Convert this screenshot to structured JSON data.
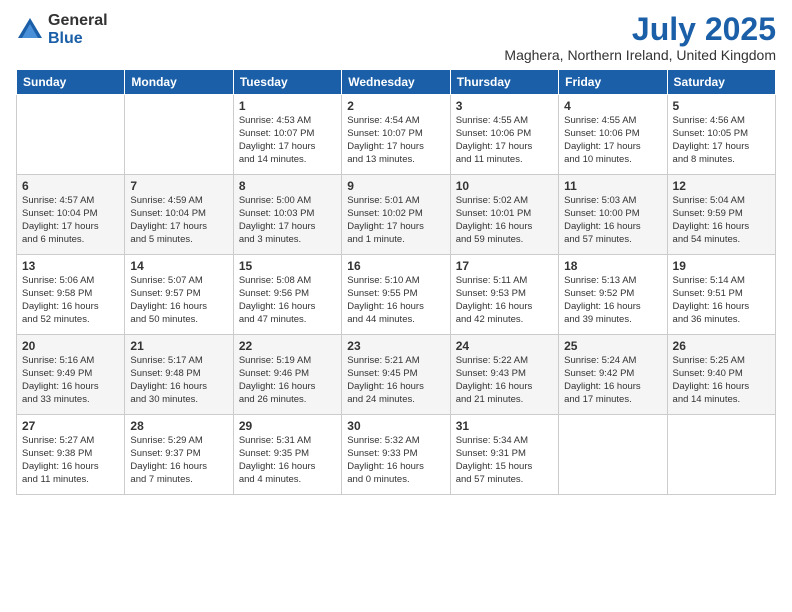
{
  "logo": {
    "general": "General",
    "blue": "Blue"
  },
  "title": {
    "month": "July 2025",
    "location": "Maghera, Northern Ireland, United Kingdom"
  },
  "headers": [
    "Sunday",
    "Monday",
    "Tuesday",
    "Wednesday",
    "Thursday",
    "Friday",
    "Saturday"
  ],
  "weeks": [
    [
      {
        "day": "",
        "info": ""
      },
      {
        "day": "",
        "info": ""
      },
      {
        "day": "1",
        "info": "Sunrise: 4:53 AM\nSunset: 10:07 PM\nDaylight: 17 hours\nand 14 minutes."
      },
      {
        "day": "2",
        "info": "Sunrise: 4:54 AM\nSunset: 10:07 PM\nDaylight: 17 hours\nand 13 minutes."
      },
      {
        "day": "3",
        "info": "Sunrise: 4:55 AM\nSunset: 10:06 PM\nDaylight: 17 hours\nand 11 minutes."
      },
      {
        "day": "4",
        "info": "Sunrise: 4:55 AM\nSunset: 10:06 PM\nDaylight: 17 hours\nand 10 minutes."
      },
      {
        "day": "5",
        "info": "Sunrise: 4:56 AM\nSunset: 10:05 PM\nDaylight: 17 hours\nand 8 minutes."
      }
    ],
    [
      {
        "day": "6",
        "info": "Sunrise: 4:57 AM\nSunset: 10:04 PM\nDaylight: 17 hours\nand 6 minutes."
      },
      {
        "day": "7",
        "info": "Sunrise: 4:59 AM\nSunset: 10:04 PM\nDaylight: 17 hours\nand 5 minutes."
      },
      {
        "day": "8",
        "info": "Sunrise: 5:00 AM\nSunset: 10:03 PM\nDaylight: 17 hours\nand 3 minutes."
      },
      {
        "day": "9",
        "info": "Sunrise: 5:01 AM\nSunset: 10:02 PM\nDaylight: 17 hours\nand 1 minute."
      },
      {
        "day": "10",
        "info": "Sunrise: 5:02 AM\nSunset: 10:01 PM\nDaylight: 16 hours\nand 59 minutes."
      },
      {
        "day": "11",
        "info": "Sunrise: 5:03 AM\nSunset: 10:00 PM\nDaylight: 16 hours\nand 57 minutes."
      },
      {
        "day": "12",
        "info": "Sunrise: 5:04 AM\nSunset: 9:59 PM\nDaylight: 16 hours\nand 54 minutes."
      }
    ],
    [
      {
        "day": "13",
        "info": "Sunrise: 5:06 AM\nSunset: 9:58 PM\nDaylight: 16 hours\nand 52 minutes."
      },
      {
        "day": "14",
        "info": "Sunrise: 5:07 AM\nSunset: 9:57 PM\nDaylight: 16 hours\nand 50 minutes."
      },
      {
        "day": "15",
        "info": "Sunrise: 5:08 AM\nSunset: 9:56 PM\nDaylight: 16 hours\nand 47 minutes."
      },
      {
        "day": "16",
        "info": "Sunrise: 5:10 AM\nSunset: 9:55 PM\nDaylight: 16 hours\nand 44 minutes."
      },
      {
        "day": "17",
        "info": "Sunrise: 5:11 AM\nSunset: 9:53 PM\nDaylight: 16 hours\nand 42 minutes."
      },
      {
        "day": "18",
        "info": "Sunrise: 5:13 AM\nSunset: 9:52 PM\nDaylight: 16 hours\nand 39 minutes."
      },
      {
        "day": "19",
        "info": "Sunrise: 5:14 AM\nSunset: 9:51 PM\nDaylight: 16 hours\nand 36 minutes."
      }
    ],
    [
      {
        "day": "20",
        "info": "Sunrise: 5:16 AM\nSunset: 9:49 PM\nDaylight: 16 hours\nand 33 minutes."
      },
      {
        "day": "21",
        "info": "Sunrise: 5:17 AM\nSunset: 9:48 PM\nDaylight: 16 hours\nand 30 minutes."
      },
      {
        "day": "22",
        "info": "Sunrise: 5:19 AM\nSunset: 9:46 PM\nDaylight: 16 hours\nand 26 minutes."
      },
      {
        "day": "23",
        "info": "Sunrise: 5:21 AM\nSunset: 9:45 PM\nDaylight: 16 hours\nand 24 minutes."
      },
      {
        "day": "24",
        "info": "Sunrise: 5:22 AM\nSunset: 9:43 PM\nDaylight: 16 hours\nand 21 minutes."
      },
      {
        "day": "25",
        "info": "Sunrise: 5:24 AM\nSunset: 9:42 PM\nDaylight: 16 hours\nand 17 minutes."
      },
      {
        "day": "26",
        "info": "Sunrise: 5:25 AM\nSunset: 9:40 PM\nDaylight: 16 hours\nand 14 minutes."
      }
    ],
    [
      {
        "day": "27",
        "info": "Sunrise: 5:27 AM\nSunset: 9:38 PM\nDaylight: 16 hours\nand 11 minutes."
      },
      {
        "day": "28",
        "info": "Sunrise: 5:29 AM\nSunset: 9:37 PM\nDaylight: 16 hours\nand 7 minutes."
      },
      {
        "day": "29",
        "info": "Sunrise: 5:31 AM\nSunset: 9:35 PM\nDaylight: 16 hours\nand 4 minutes."
      },
      {
        "day": "30",
        "info": "Sunrise: 5:32 AM\nSunset: 9:33 PM\nDaylight: 16 hours\nand 0 minutes."
      },
      {
        "day": "31",
        "info": "Sunrise: 5:34 AM\nSunset: 9:31 PM\nDaylight: 15 hours\nand 57 minutes."
      },
      {
        "day": "",
        "info": ""
      },
      {
        "day": "",
        "info": ""
      }
    ]
  ]
}
